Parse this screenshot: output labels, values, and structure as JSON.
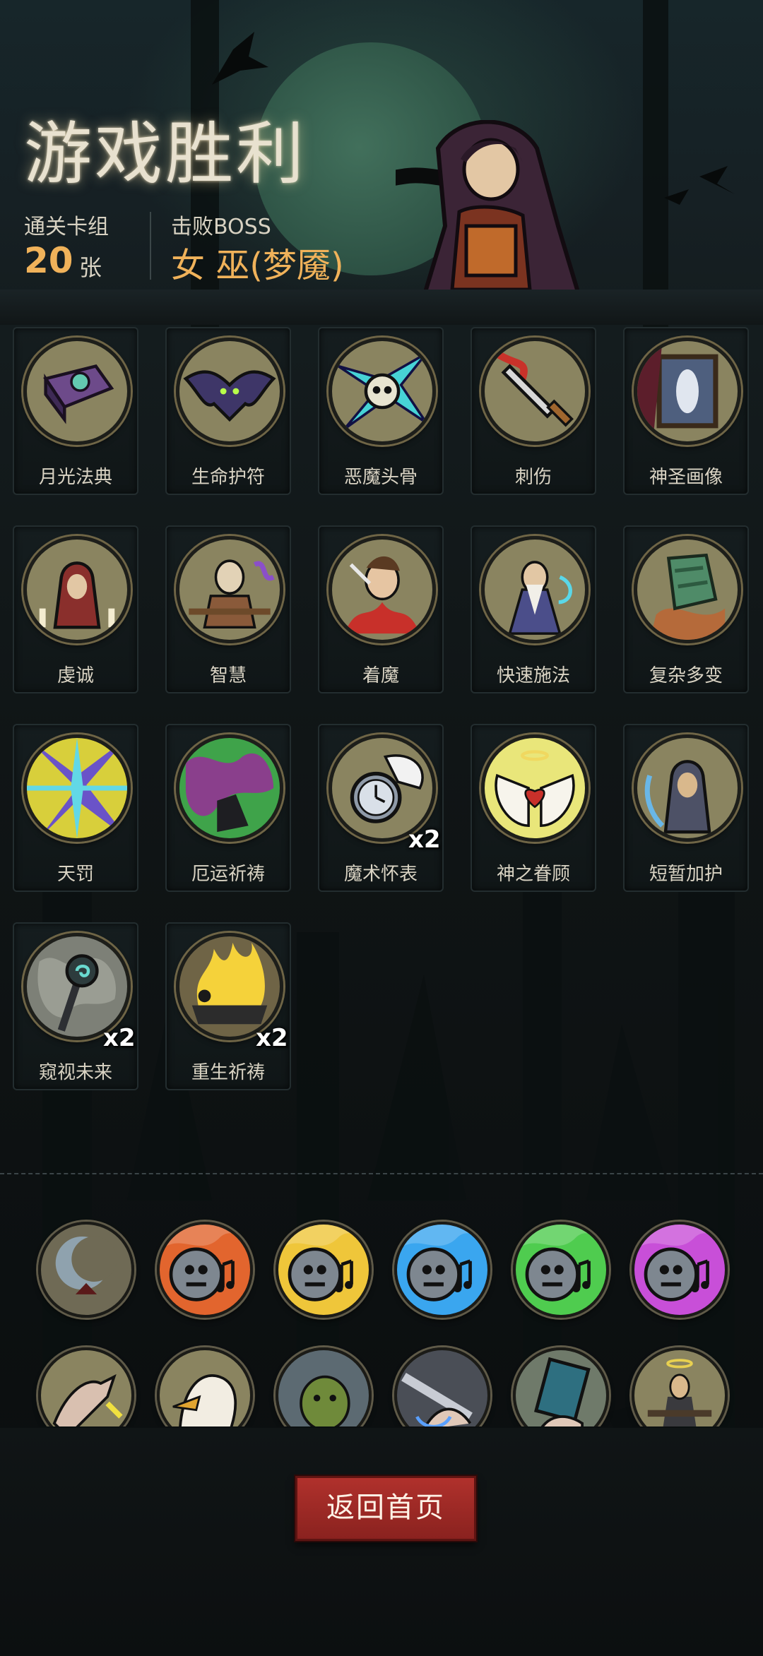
{
  "header": {
    "title": "游戏胜利",
    "deck_label": "通关卡组",
    "deck_count": "20",
    "deck_unit": "张",
    "boss_label": "击败BOSS",
    "boss_name": "女 巫(梦魇)"
  },
  "cards": [
    {
      "name": "月光法典",
      "count": ""
    },
    {
      "name": "生命护符",
      "count": ""
    },
    {
      "name": "恶魔头骨",
      "count": ""
    },
    {
      "name": "刺伤",
      "count": ""
    },
    {
      "name": "神圣画像",
      "count": ""
    },
    {
      "name": "虔诚",
      "count": ""
    },
    {
      "name": "智慧",
      "count": ""
    },
    {
      "name": "着魔",
      "count": ""
    },
    {
      "name": "快速施法",
      "count": ""
    },
    {
      "name": "复杂多变",
      "count": ""
    },
    {
      "name": "天罚",
      "count": ""
    },
    {
      "name": "厄运祈祷",
      "count": ""
    },
    {
      "name": "魔术怀表",
      "count": "x2"
    },
    {
      "name": "神之眷顾",
      "count": ""
    },
    {
      "name": "短暂加护",
      "count": ""
    },
    {
      "name": "窥视未来",
      "count": "x2"
    },
    {
      "name": "重生祈祷",
      "count": "x2"
    }
  ],
  "relics_row1": [
    "crescent-moon-relic",
    "orange-music-relic",
    "yellow-music-relic",
    "blue-music-relic",
    "green-music-relic",
    "purple-music-relic"
  ],
  "relics_row2": [
    "pinch-hand-relic",
    "eagle-relic",
    "ogre-relic",
    "blade-hand-relic",
    "card-hand-relic",
    "priest-relic"
  ],
  "buttons": {
    "home": "返回首页"
  }
}
